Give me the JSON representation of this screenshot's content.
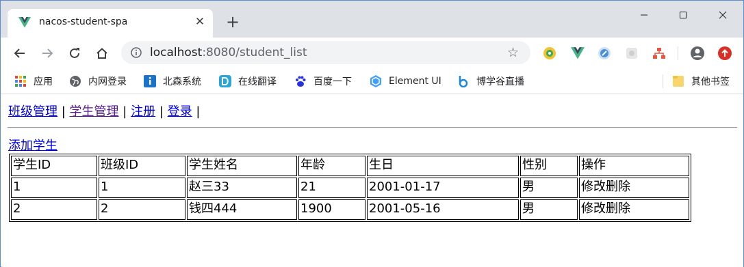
{
  "browser": {
    "tab_title": "nacos-student-spa",
    "tab_close": "✕",
    "new_tab": "+",
    "url_host": "localhost",
    "url_rest": ":8080/student_list",
    "bookmarks": [
      {
        "label": "应用",
        "icon": "apps-grid-icon"
      },
      {
        "label": "内网登录",
        "icon": "globe-icon"
      },
      {
        "label": "北森系统",
        "icon": "info-bookmark-icon"
      },
      {
        "label": "在线翻译",
        "icon": "translate-d-icon"
      },
      {
        "label": "百度一下",
        "icon": "baidu-paw-icon"
      },
      {
        "label": "Element UI",
        "icon": "element-hex-icon"
      },
      {
        "label": "博学谷直播",
        "icon": "bilibili-icon"
      },
      {
        "label": "其他书签",
        "icon": "folder-icon"
      }
    ],
    "colors": {
      "tabstrip": "#dee1e6",
      "omnibox": "#f1f3f4",
      "vue_green": "#41b883",
      "vue_dark": "#35495e"
    }
  },
  "page": {
    "nav": [
      {
        "label": "班级管理",
        "visited": false
      },
      {
        "label": "学生管理",
        "visited": true
      },
      {
        "label": "注册",
        "visited": false
      },
      {
        "label": "登录",
        "visited": false
      }
    ],
    "separator": "|",
    "add_student": "添加学生",
    "table": {
      "headers": [
        "学生ID",
        "班级ID",
        "学生姓名",
        "年龄",
        "生日",
        "性别",
        "操作"
      ],
      "rows": [
        [
          "1",
          "1",
          "赵三33",
          "21",
          "2001-01-17",
          "男",
          "修改删除"
        ],
        [
          "2",
          "2",
          "钱四444",
          "1900",
          "2001-05-16",
          "男",
          "修改删除"
        ]
      ]
    }
  }
}
